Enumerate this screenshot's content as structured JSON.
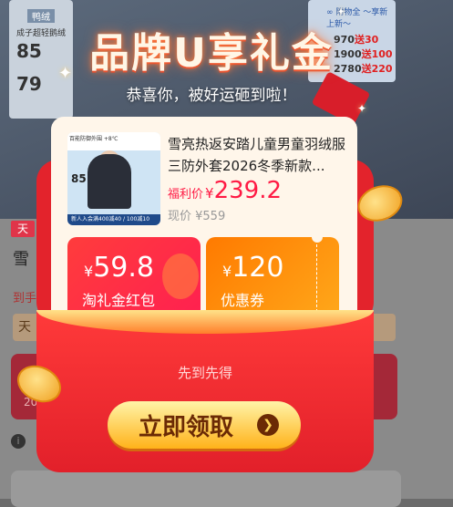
{
  "background": {
    "left_card": [
      "鸭绒",
      "成子超轻鹅绒",
      "85",
      "79"
    ],
    "right_card": {
      "tag": "∞ 附物全 ～享新上新～",
      "rows": [
        {
          "a": "970",
          "b": "30"
        },
        {
          "a": "1900",
          "b": "100"
        },
        {
          "a": "2780",
          "b": "220"
        }
      ],
      "sep": "送"
    },
    "tag": "天",
    "title_fragment": "雪",
    "sub_fragment": "到手",
    "strip_fragment": "天",
    "btn_fragment": "20",
    "info_icon": "i"
  },
  "modal": {
    "title": "品牌U享礼金",
    "subtitle": "恭喜你，被好运砸到啦！",
    "product": {
      "title": "雪亮热返安踏儿童男童羽绒服三防外套2026冬季新款...",
      "price_label": "福利价",
      "currency": "¥",
      "price": "239.2",
      "original_label": "现价 ¥559",
      "image_header": "百能防御外围 +8℃",
      "image_footer": "新人入会满400减40 / 100减10",
      "image_big": "85"
    },
    "coupons": [
      {
        "currency": "¥",
        "value": "59.8",
        "name": "淘礼金红包"
      },
      {
        "currency": "¥",
        "value": "120",
        "name": "优惠券"
      }
    ],
    "first_come": "先到先得",
    "claim_button": "立即领取",
    "claim_arrow": "❯"
  }
}
